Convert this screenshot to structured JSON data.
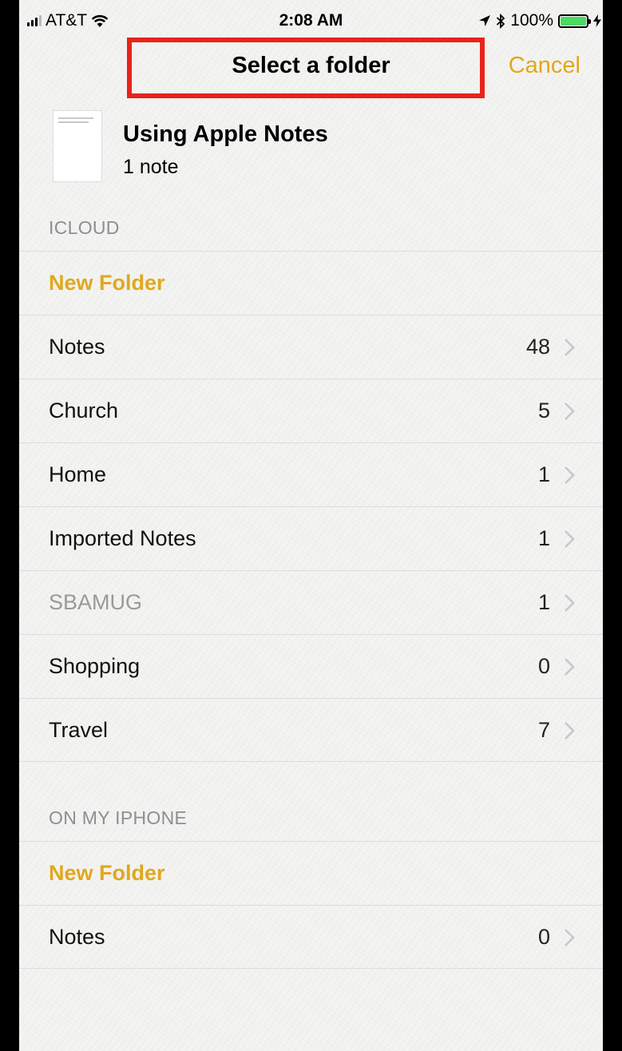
{
  "status_bar": {
    "carrier": "AT&T",
    "time": "2:08 AM",
    "battery": "100%",
    "icons": [
      "signal-icon",
      "wifi-icon",
      "location-icon",
      "bluetooth-icon",
      "battery-icon",
      "charging-icon"
    ]
  },
  "nav": {
    "title": "Select a folder",
    "cancel_label": "Cancel"
  },
  "note": {
    "title": "Using Apple Notes",
    "count": "1 note"
  },
  "sections": [
    {
      "header": "ICLOUD",
      "new_folder_label": "New Folder",
      "folders": [
        {
          "name": "Notes",
          "count": "48"
        },
        {
          "name": "Church",
          "count": "5"
        },
        {
          "name": "Home",
          "count": "1"
        },
        {
          "name": "Imported Notes",
          "count": "1"
        },
        {
          "name": "SBAMUG",
          "count": "1"
        },
        {
          "name": "Shopping",
          "count": "0"
        },
        {
          "name": "Travel",
          "count": "7"
        }
      ]
    },
    {
      "header": "ON MY IPHONE",
      "new_folder_label": "New Folder",
      "folders": [
        {
          "name": "Notes",
          "count": "0"
        }
      ]
    }
  ],
  "colors": {
    "accent": "#e0a81d",
    "highlight_box": "#e8231a",
    "background": "#f4f4f2"
  }
}
